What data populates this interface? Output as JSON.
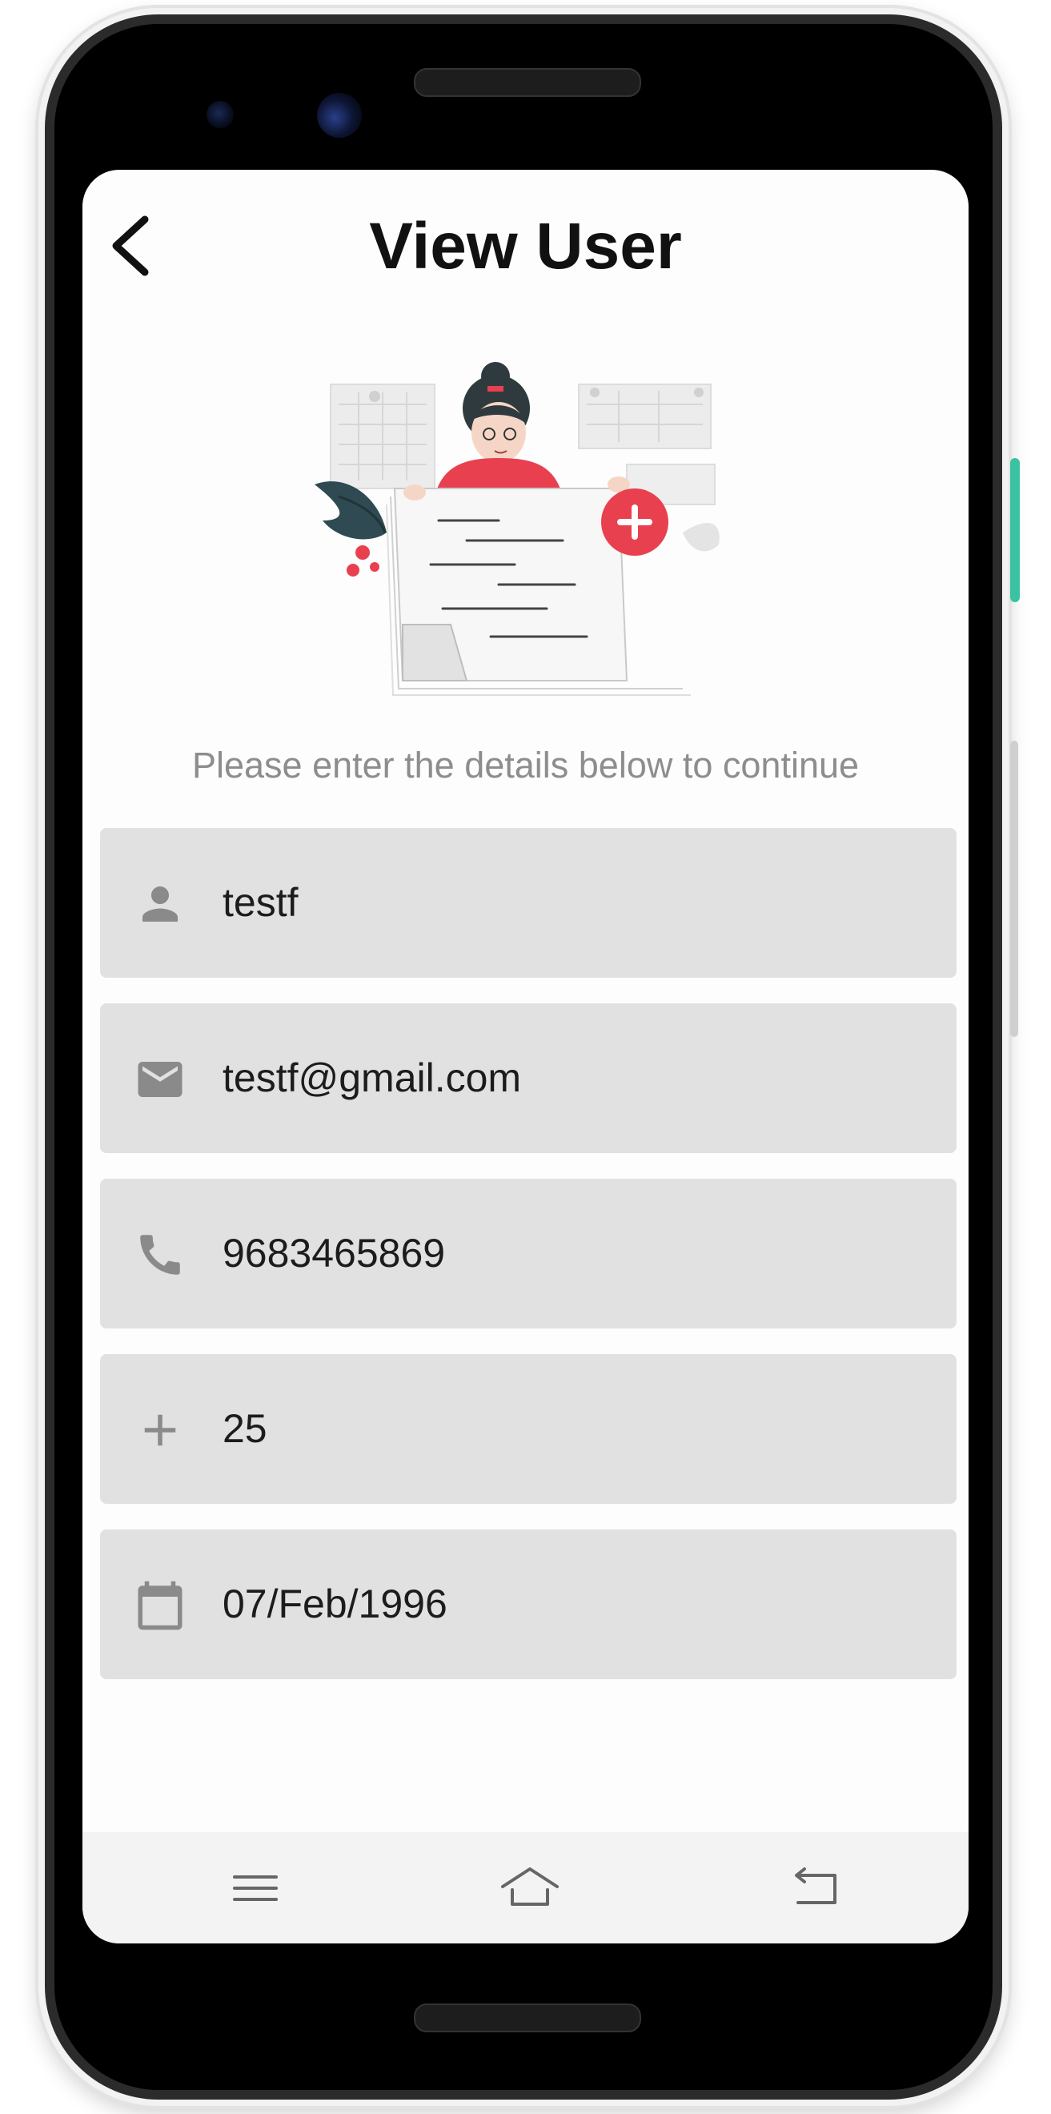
{
  "header": {
    "title": "View User"
  },
  "subtitle": "Please enter the details below to continue",
  "fields": {
    "name": {
      "icon": "person-icon",
      "value": "testf"
    },
    "email": {
      "icon": "email-icon",
      "value": "testf@gmail.com"
    },
    "phone": {
      "icon": "phone-icon",
      "value": "9683465869"
    },
    "age": {
      "icon": "plus-icon",
      "value": "25"
    },
    "dob": {
      "icon": "calendar-icon",
      "value": "07/Feb/1996"
    }
  },
  "navbar": {
    "icons": [
      "menu-icon",
      "home-icon",
      "back-icon"
    ]
  },
  "colors": {
    "field_bg": "#e1e1e1",
    "icon_gray": "#8a8a8a",
    "accent_red": "#e8404f",
    "accent_teal": "#2f4a52"
  }
}
